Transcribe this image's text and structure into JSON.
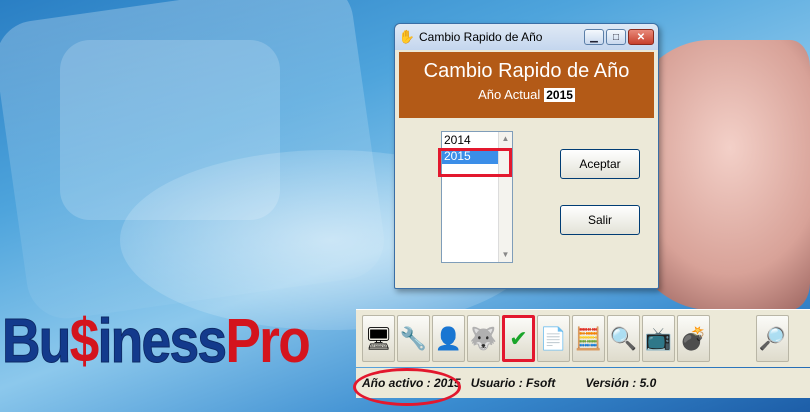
{
  "dialog": {
    "title": "Cambio Rapido de Año",
    "banner_title": "Cambio Rapido de Año",
    "current_year_label": "Año Actual",
    "current_year_value": "2015",
    "years": [
      "2014",
      "2015"
    ],
    "selected_year": "2015",
    "accept_label": "Aceptar",
    "exit_label": "Salir"
  },
  "logo": {
    "part1": "Bu",
    "part2": "$",
    "part3": "iness",
    "part4": "Pro"
  },
  "toolbar": {
    "icons": [
      "monitor-icon",
      "tools-icon",
      "user-icon",
      "gimp-icon",
      "checkmark-icon",
      "document-icon",
      "calculator-icon",
      "search-icon",
      "display-icon",
      "bomb-icon",
      "help-search-icon"
    ]
  },
  "status": {
    "active_year": "Año activo : 2015",
    "user": "Usuario : Fsoft",
    "version": "Versión : 5.0"
  }
}
